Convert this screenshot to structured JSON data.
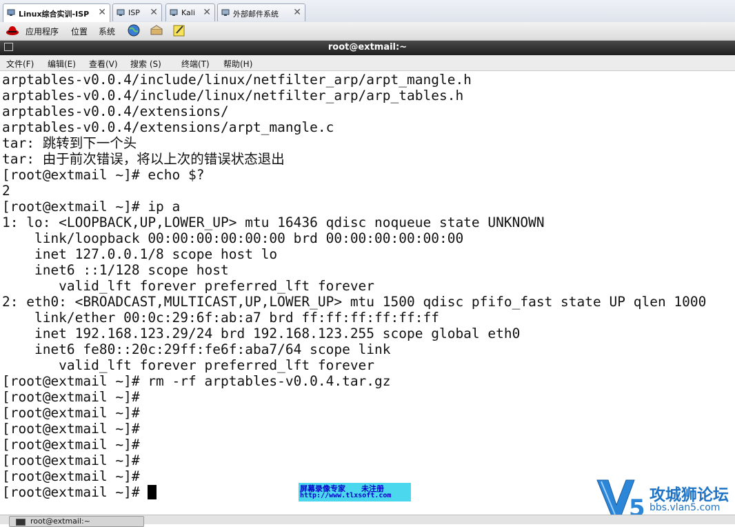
{
  "vm_tabs": [
    {
      "label": "Linux综合实训-ISP",
      "active": true
    },
    {
      "label": "ISP",
      "active": false
    },
    {
      "label": "Kali",
      "active": false
    },
    {
      "label": "外部邮件系统",
      "active": false
    }
  ],
  "tab_close_glyph": "✕",
  "panel": {
    "applications": "应用程序",
    "places": "位置",
    "system": "系统"
  },
  "window": {
    "title": "root@extmail:~"
  },
  "menu": [
    "文件(F)",
    "编辑(E)",
    "查看(V)",
    "搜索 (S)",
    "终端(T)",
    "帮助(H)"
  ],
  "terminal_lines": [
    "arptables-v0.0.4/include/linux/netfilter_arp/arpt_mangle.h",
    "arptables-v0.0.4/include/linux/netfilter_arp/arp_tables.h",
    "arptables-v0.0.4/extensions/",
    "arptables-v0.0.4/extensions/arpt_mangle.c",
    "tar: 跳转到下一个头",
    "tar: 由于前次错误，将以上次的错误状态退出",
    "[root@extmail ~]# echo $?",
    "2",
    "[root@extmail ~]# ip a",
    "1: lo: <LOOPBACK,UP,LOWER_UP> mtu 16436 qdisc noqueue state UNKNOWN",
    "    link/loopback 00:00:00:00:00:00 brd 00:00:00:00:00:00",
    "    inet 127.0.0.1/8 scope host lo",
    "    inet6 ::1/128 scope host",
    "       valid_lft forever preferred_lft forever",
    "2: eth0: <BROADCAST,MULTICAST,UP,LOWER_UP> mtu 1500 qdisc pfifo_fast state UP qlen 1000",
    "    link/ether 00:0c:29:6f:ab:a7 brd ff:ff:ff:ff:ff:ff",
    "    inet 192.168.123.29/24 brd 192.168.123.255 scope global eth0",
    "    inet6 fe80::20c:29ff:fe6f:aba7/64 scope link",
    "       valid_lft forever preferred_lft forever",
    "[root@extmail ~]# rm -rf arptables-v0.0.4.tar.gz",
    "[root@extmail ~]#",
    "[root@extmail ~]#",
    "[root@extmail ~]#",
    "[root@extmail ~]#",
    "[root@extmail ~]#",
    "[root@extmail ~]#"
  ],
  "prompt_last": "[root@extmail ~]# ",
  "watermark": {
    "line1": "屏幕录像专家      未注册",
    "line2": "http://www.tlxsoft.com"
  },
  "logo": {
    "name": "攻城狮论坛",
    "url": "bbs.vlan5.com"
  },
  "taskbar": {
    "window_label": "root@extmail:~"
  }
}
